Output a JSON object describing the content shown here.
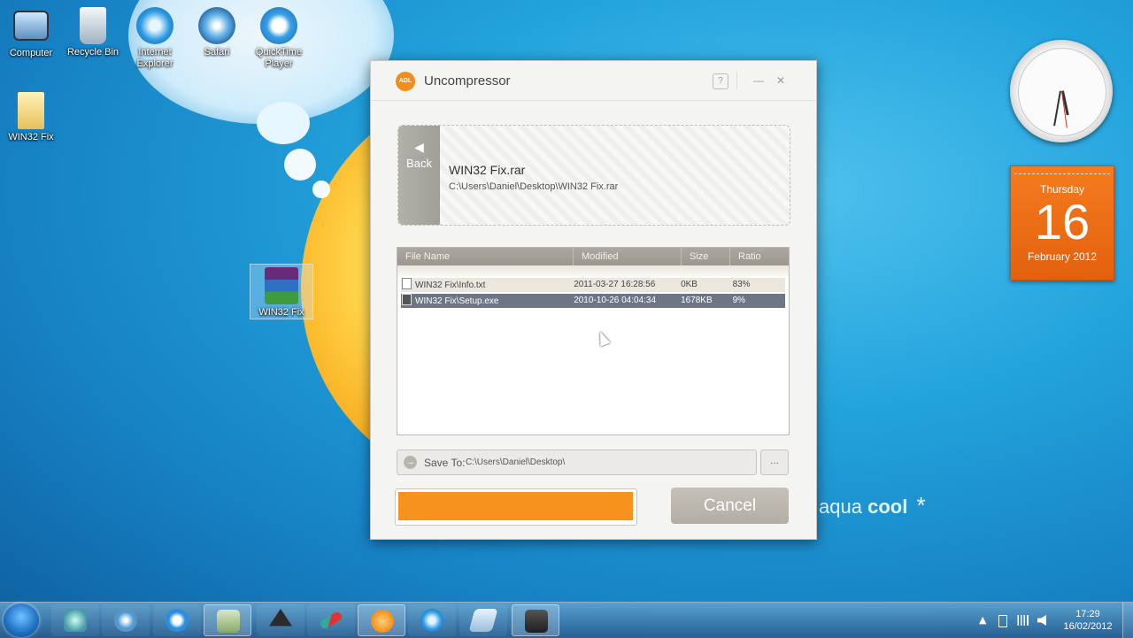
{
  "desktop": {
    "icons": [
      {
        "label": "Computer"
      },
      {
        "label": "Recycle Bin"
      },
      {
        "label": "Internet Explorer"
      },
      {
        "label": "Safari"
      },
      {
        "label": "QuickTime Player"
      },
      {
        "label": "WIN32 Fix"
      },
      {
        "label": "WIN32 Fix"
      }
    ],
    "wallpaper_brand": {
      "light": "aqua",
      "bold": "cool",
      "symbol": "*"
    }
  },
  "gadgets": {
    "calendar": {
      "weekday": "Thursday",
      "day": "16",
      "month_year": "February 2012"
    },
    "clock": {
      "time": "17:29"
    }
  },
  "dialog": {
    "logo": "ADL",
    "title": "Uncompressor",
    "help": "?",
    "minimize": "—",
    "close": "✕",
    "back_arrow": "◀",
    "back_label": "Back",
    "archive_name": "WIN32 Fix.rar",
    "archive_path": "C:\\Users\\Daniel\\Desktop\\WIN32 Fix.rar",
    "columns": [
      "File Name",
      "Modified",
      "Size",
      "Ratio"
    ],
    "files": [
      {
        "name": "WIN32 Fix\\Info.txt",
        "modified": "2011-03-27 16:28:56",
        "size": "0KB",
        "ratio": "83%"
      },
      {
        "name": "WIN32 Fix\\Setup.exe",
        "modified": "2010-10-26 04:04:34",
        "size": "1678KB",
        "ratio": "9%"
      }
    ],
    "save_to_label": "Save To:",
    "save_to_path": "C:\\Users\\Daniel\\Desktop\\",
    "browse_label": "...",
    "cancel_label": "Cancel",
    "colors": {
      "accent": "#f7921e",
      "selected_row": "#6e7686",
      "header": "#a39f96"
    }
  },
  "taskbar": {
    "time": "17:29",
    "date": "16/02/2012",
    "tray_arrow": "▲",
    "pinned": [
      "windows-explorer",
      "safari",
      "quicktime",
      "image-viewer",
      "unity",
      "pencil-app",
      "uncompressor",
      "internet-explorer",
      "note-app",
      "camcorder"
    ]
  }
}
